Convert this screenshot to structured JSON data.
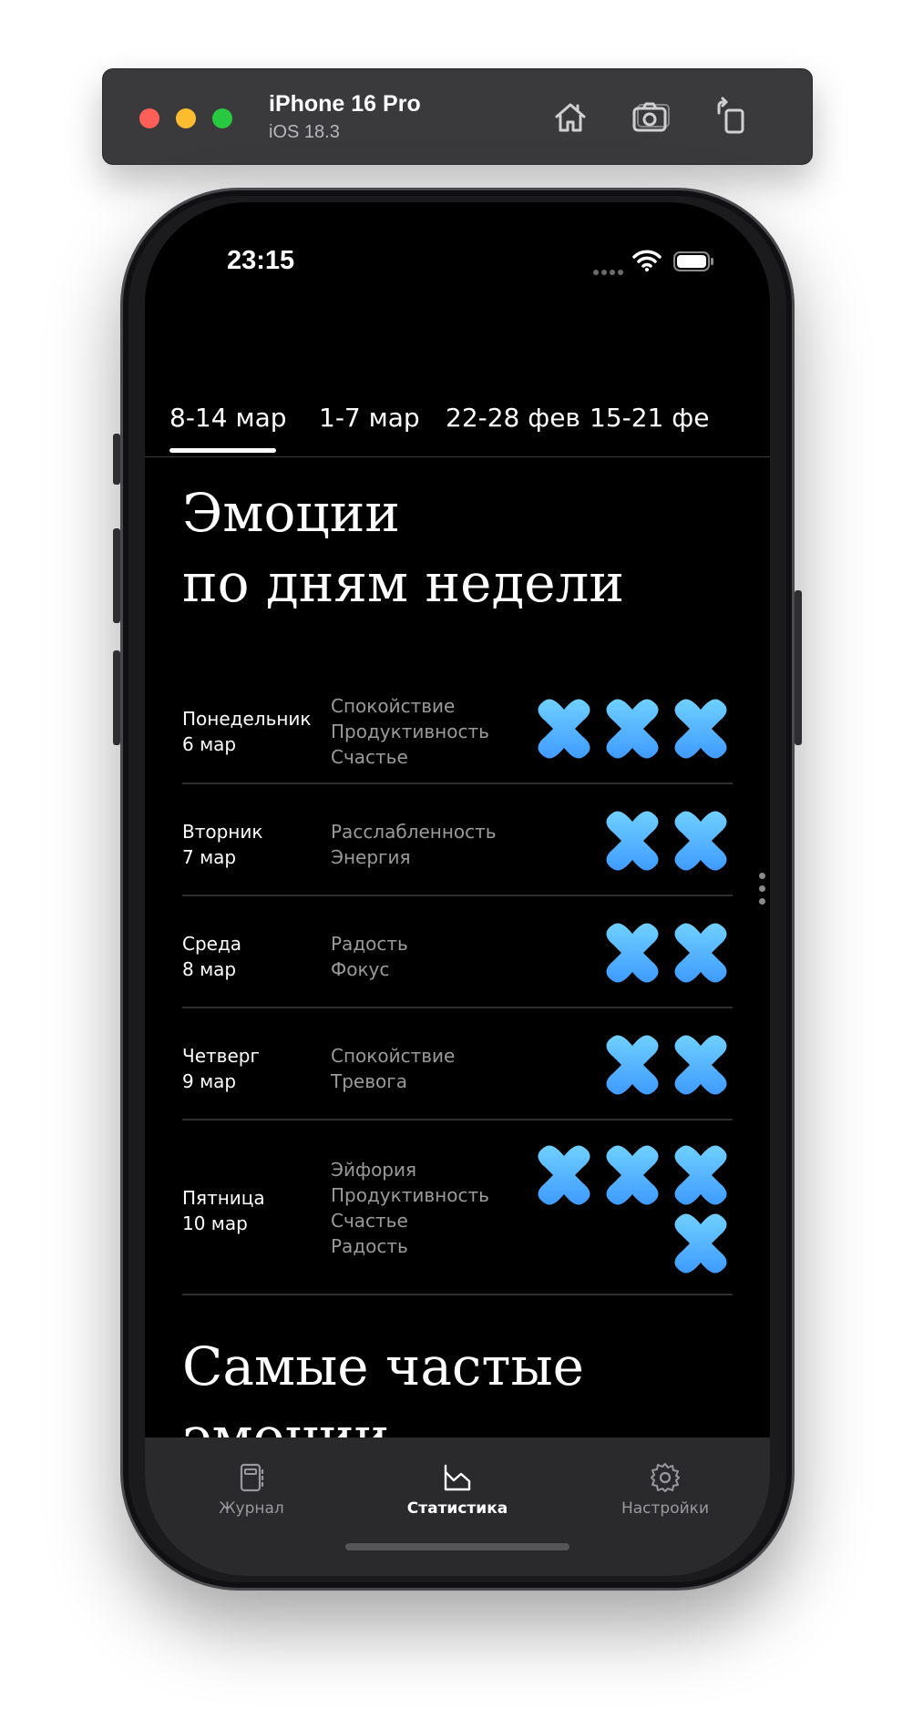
{
  "simulator": {
    "device": "iPhone 16 Pro",
    "os": "iOS 18.3",
    "buttons": [
      "home-icon",
      "screenshot-icon",
      "rotate-icon"
    ]
  },
  "status_bar": {
    "time": "23:15"
  },
  "week_tabs": [
    {
      "label": "8-14 мар",
      "selected": true
    },
    {
      "label": "1-7 мар",
      "selected": false
    },
    {
      "label": "22-28 фев",
      "selected": false
    },
    {
      "label": "15-21 фе",
      "selected": false
    }
  ],
  "section_by_day": {
    "title_line1": "Эмоции",
    "title_line2": "по дням недели"
  },
  "days": [
    {
      "name": "Понедельник",
      "date": "6 мар",
      "emotions": [
        "Спокойствие",
        "Продуктивность",
        "Счастье"
      ],
      "mark_count": 3
    },
    {
      "name": "Вторник",
      "date": "7 мар",
      "emotions": [
        "Расслабленность",
        "Энергия"
      ],
      "mark_count": 2
    },
    {
      "name": "Среда",
      "date": "8 мар",
      "emotions": [
        "Радость",
        "Фокус"
      ],
      "mark_count": 2
    },
    {
      "name": "Четверг",
      "date": "9 мар",
      "emotions": [
        "Спокойствие",
        "Тревога"
      ],
      "mark_count": 2
    },
    {
      "name": "Пятница",
      "date": "10 мар",
      "emotions": [
        "Эйфория",
        "Продуктивность",
        "Счастье",
        "Радость"
      ],
      "mark_count": 4
    }
  ],
  "section_frequent": {
    "title_line1": "Самые частые",
    "title_line2": "эмоции"
  },
  "bottom_nav": [
    {
      "label": "Журнал",
      "icon": "journal-icon",
      "active": false
    },
    {
      "label": "Статистика",
      "icon": "chart-icon",
      "active": true
    },
    {
      "label": "Настройки",
      "icon": "gear-icon",
      "active": false
    }
  ],
  "colors": {
    "mark_top": "#6fd0ff",
    "mark_bottom": "#3f9bff",
    "nav_active": "#ffffff",
    "nav_inactive": "#9a9a9e"
  }
}
